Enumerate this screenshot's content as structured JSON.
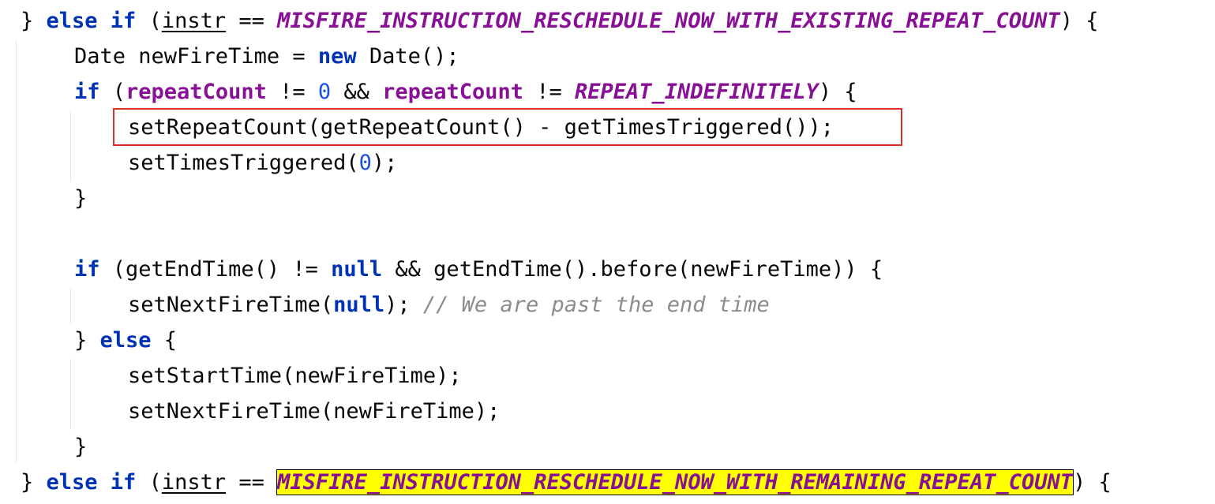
{
  "code": {
    "l1": [
      "} ",
      "else if",
      " (",
      "instr",
      " == ",
      "MISFIRE_INSTRUCTION_RESCHEDULE_NOW_WITH_EXISTING_REPEAT_COUNT",
      ") {"
    ],
    "l2": [
      "Date newFireTime = ",
      "new",
      " Date();"
    ],
    "l3": [
      "if",
      " (",
      "repeatCount",
      " != ",
      "0",
      " && ",
      "repeatCount",
      " != ",
      "REPEAT_INDEFINITELY",
      ") {"
    ],
    "l4": [
      "setRepeatCount(getRepeatCount() - getTimesTriggered());"
    ],
    "l5": [
      "setTimesTriggered(",
      "0",
      ");"
    ],
    "l6": [
      "}"
    ],
    "l8": [
      "if",
      " (getEndTime() != ",
      "null",
      " && getEndTime().before(newFireTime)) {"
    ],
    "l9": [
      "setNextFireTime(",
      "null",
      "); ",
      "// We are past the end time"
    ],
    "l10": [
      "} ",
      "else",
      " {"
    ],
    "l11": [
      "setStartTime(newFireTime);"
    ],
    "l12": [
      "setNextFireTime(newFireTime);"
    ],
    "l13": [
      "}"
    ],
    "l14": [
      "} ",
      "else if",
      " (",
      "instr",
      " == ",
      "MISFIRE_INSTRUCTION_RESCHEDULE_NOW_WITH_REMAINING_REPEAT_COUNT",
      ") {"
    ]
  },
  "colors": {
    "keyword": "#0033b3",
    "field": "#871094",
    "number": "#1750eb",
    "comment": "#8c8c8c",
    "highlight": "#ffff00",
    "annotation_box": "#d9302c"
  }
}
